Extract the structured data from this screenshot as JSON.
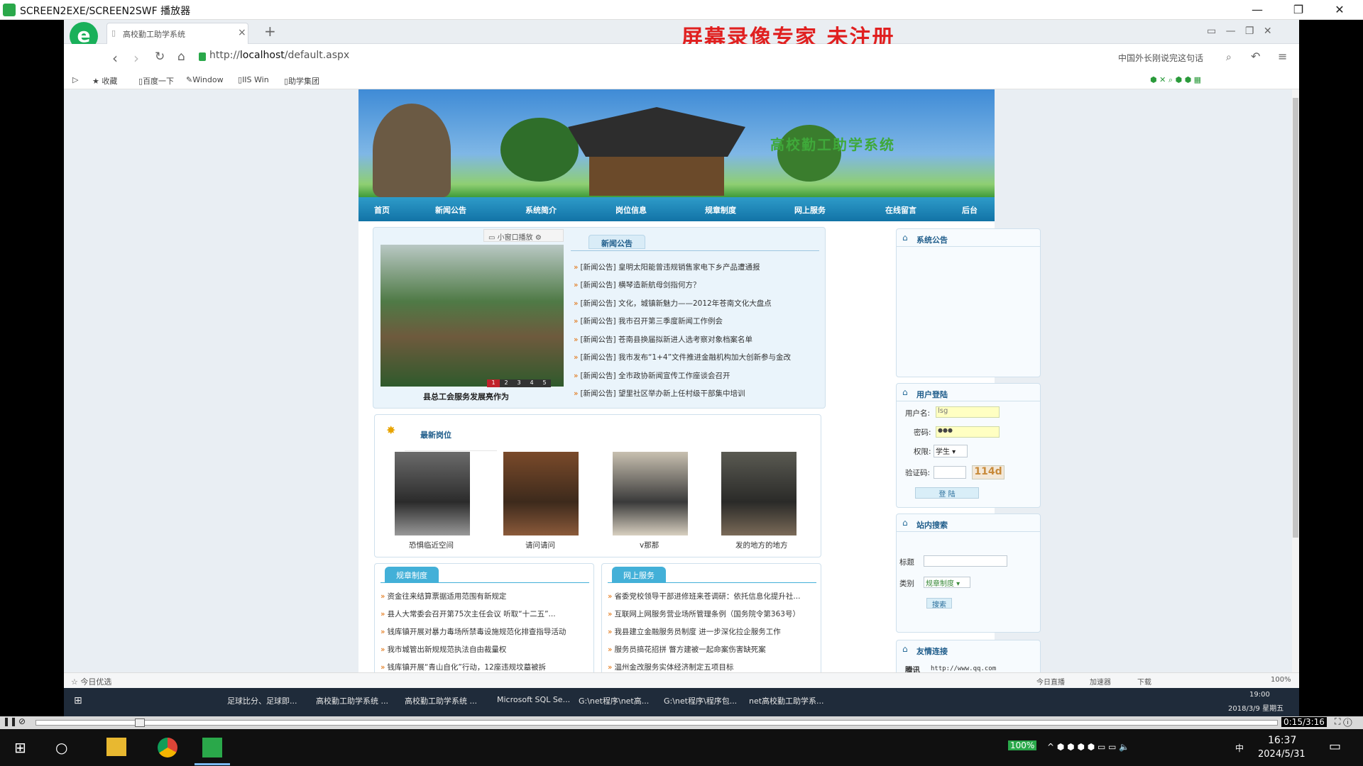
{
  "window": {
    "title": "SCREEN2EXE/SCREEN2SWF 播放器",
    "min": "—",
    "restore": "❐",
    "close": "✕"
  },
  "browser": {
    "tab_title": "高校勤工助学系统",
    "tab_close": "×",
    "new_tab": "+",
    "address_prefix": "http://",
    "address_host": "localhost",
    "address_path": "/default.aspx",
    "search_hint": "中国外长刚说完这句话",
    "bookmarks": [
      "收藏",
      "百度一下",
      "Window",
      "IIS Win",
      "助学集团"
    ],
    "status_left": "今日优选",
    "status_right": [
      "今日直播",
      "加速器",
      "下载",
      "100%"
    ]
  },
  "watermark": "屏幕录像专家  未注册",
  "site": {
    "banner_title": "高校勤工助学系统",
    "menu": [
      "首页",
      "新闻公告",
      "系统简介",
      "岗位信息",
      "规章制度",
      "网上服务",
      "在线留言",
      "后台"
    ],
    "slider": {
      "popup_label": "小窗口播放",
      "caption": "县总工会服务发展亮作为",
      "pages": [
        "1",
        "2",
        "3",
        "4",
        "5"
      ]
    },
    "news": {
      "tab": "新闻公告",
      "items": [
        "[新闻公告] 皇明太阳能曾违规销售家电下乡产品遭通报",
        "[新闻公告] 横琴造新航母剑指何方？",
        "[新闻公告] 文化，城镇新魅力——2012年苍南文化大盘点",
        "[新闻公告] 我市召开第三季度新闻工作例会",
        "[新闻公告] 苍南县换届拟新进人选考察对象档案名单",
        "[新闻公告] 我市发布“1+4”文件推进金融机构加大创新参与金改",
        "[新闻公告] 全市政协新闻宣传工作座谈会召开",
        "[新闻公告] 望里社区举办新上任村级干部集中培训"
      ]
    },
    "jobs": {
      "title": "最新岗位",
      "items": [
        "恐惧临近空间",
        "请问请问",
        "v那那",
        "发的地方的地方"
      ]
    },
    "rules": {
      "tab": "规章制度",
      "items": [
        "资金往来结算票据适用范围有新规定",
        "县人大常委会召开第75次主任会议 听取“十二五”...",
        "钱库镇开展对暴力毒场所禁毒设施规范化排查指导活动",
        "我市城管出新规规范执法自由裁量权",
        "钱库镇开展“青山自化”行动，12座违规坟墓被拆"
      ]
    },
    "services": {
      "tab": "网上服务",
      "items": [
        "省委党校领导干部进修班来苍调研：依托信息化提升社...",
        "互联网上网服务营业场所管理条例（国务院令第363号）",
        "我县建立金融服务员制度 进一步深化拉企服务工作",
        "服务员搞花招拼 瞥方建被一起命案伤害缺死案",
        "温州金改服务实体经济制定五项目标"
      ]
    },
    "sys_notice": {
      "title": "系统公告"
    },
    "login": {
      "title": "用户登陆",
      "user_label": "用户名:",
      "user_value": "lsg",
      "pwd_label": "密码:",
      "pwd_value": "●●●",
      "role_label": "权限:",
      "role_value": "学生",
      "code_label": "验证码:",
      "code_image": "114d",
      "submit": "登 陆"
    },
    "search": {
      "title": "站内搜索",
      "title_label": "标题",
      "type_label": "类别",
      "type_value": "规章制度",
      "button": "搜索"
    },
    "links": {
      "title": "友情连接",
      "name": "腾讯",
      "url": "http://www.qq.com"
    }
  },
  "taskbar_apps": [
    "足球比分、足球即...",
    "高校勤工助学系统 ...",
    "高校勤工助学系统 ...",
    "Microsoft SQL Se...",
    "G:\\net程序\\net高...",
    "G:\\net程序\\程序包...",
    "net高校勤工助学系..."
  ],
  "inner_clock": {
    "time": "19:00",
    "date": "2018/3/9 星期五"
  },
  "player": {
    "time": "0:15/3:16"
  },
  "system_tray": {
    "battery": "100%",
    "ime": "中",
    "time": "16:37",
    "date": "2024/5/31"
  }
}
